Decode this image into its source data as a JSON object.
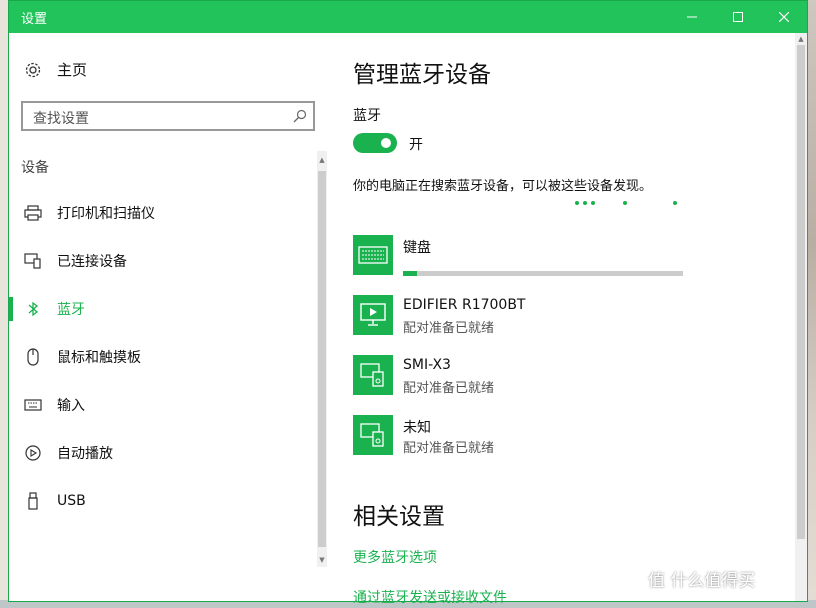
{
  "window": {
    "title": "设置"
  },
  "nav": {
    "home_label": "主页",
    "search_placeholder": "查找设置",
    "section_title": "设备",
    "items": [
      {
        "label": "打印机和扫描仪",
        "icon": "printer-icon"
      },
      {
        "label": "已连接设备",
        "icon": "connected-devices-icon"
      },
      {
        "label": "蓝牙",
        "icon": "bluetooth-icon",
        "active": true
      },
      {
        "label": "鼠标和触摸板",
        "icon": "mouse-icon"
      },
      {
        "label": "输入",
        "icon": "keyboard-icon"
      },
      {
        "label": "自动播放",
        "icon": "autoplay-icon"
      },
      {
        "label": "USB",
        "icon": "usb-icon"
      }
    ]
  },
  "main": {
    "title": "管理蓝牙设备",
    "bluetooth_label": "蓝牙",
    "toggle_state": "开",
    "toggle_on": true,
    "discover_text": "你的电脑正在搜索蓝牙设备，可以被这些设备发现。",
    "devices": [
      {
        "name": "键盘",
        "status": "",
        "icon": "keyboard-device-icon",
        "progress": 0.05
      },
      {
        "name": "EDIFIER R1700BT",
        "status": "配对准备已就绪",
        "icon": "display-device-icon"
      },
      {
        "name": "SMI-X3",
        "status": "配对准备已就绪",
        "icon": "phone-pc-device-icon"
      },
      {
        "name": "未知",
        "status": "配对准备已就绪",
        "icon": "phone-pc-device-icon"
      }
    ],
    "related_title": "相关设置",
    "links": [
      "更多蓝牙选项",
      "通过蓝牙发送或接收文件"
    ]
  },
  "watermark": "值 什么值得买",
  "colors": {
    "accent": "#1ab24f",
    "titlebar": "#21c35a"
  }
}
